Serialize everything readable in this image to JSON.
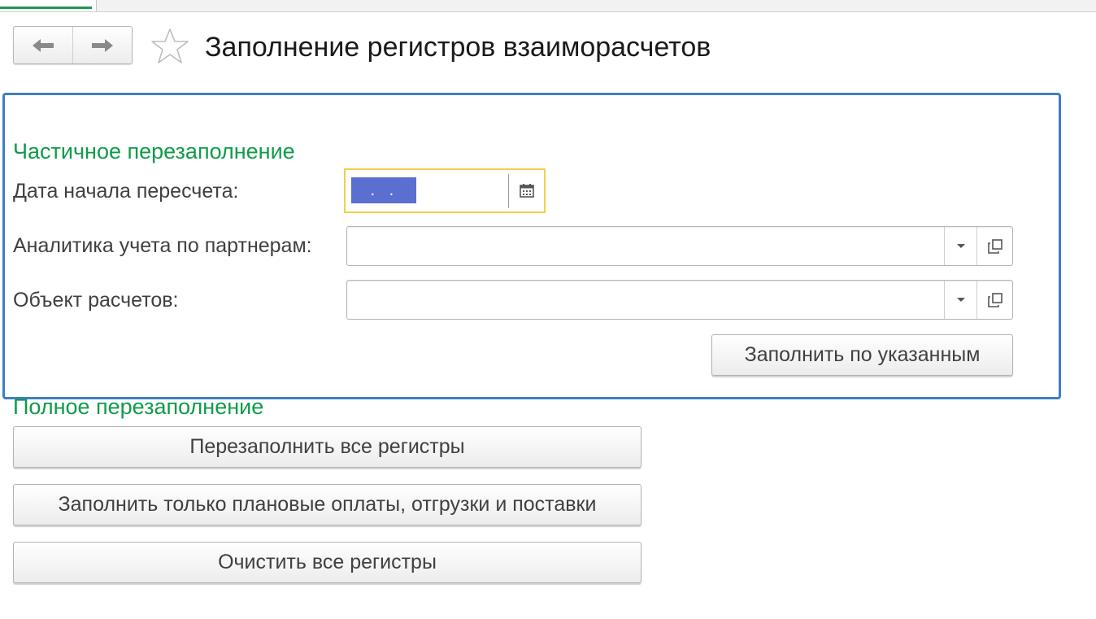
{
  "header": {
    "title": "Заполнение регистров взаиморасчетов"
  },
  "partial": {
    "group_title": "Частичное перезаполнение",
    "date_label": "Дата начала пересчета:",
    "date_value": " . .",
    "partner_label": "Аналитика учета по партнерам:",
    "partner_value": "",
    "object_label": "Объект расчетов:",
    "object_value": "",
    "fill_button": "Заполнить по указанным"
  },
  "full": {
    "group_title": "Полное перезаполнение",
    "refill_all_button": "Перезаполнить все регистры",
    "fill_planned_button": "Заполнить только плановые оплаты, отгрузки и поставки",
    "clear_all_button": "Очистить все регистры"
  },
  "colors": {
    "group_title": "#0f9b4a",
    "group_border": "#3f7fc2",
    "focus_border": "#f2cf4a",
    "selection": "#5a6fd0"
  },
  "icons": {
    "back": "arrow-left-icon",
    "forward": "arrow-right-icon",
    "favorite": "star-icon",
    "calendar": "calendar-icon",
    "dropdown": "chevron-down-icon",
    "open": "open-form-icon"
  }
}
